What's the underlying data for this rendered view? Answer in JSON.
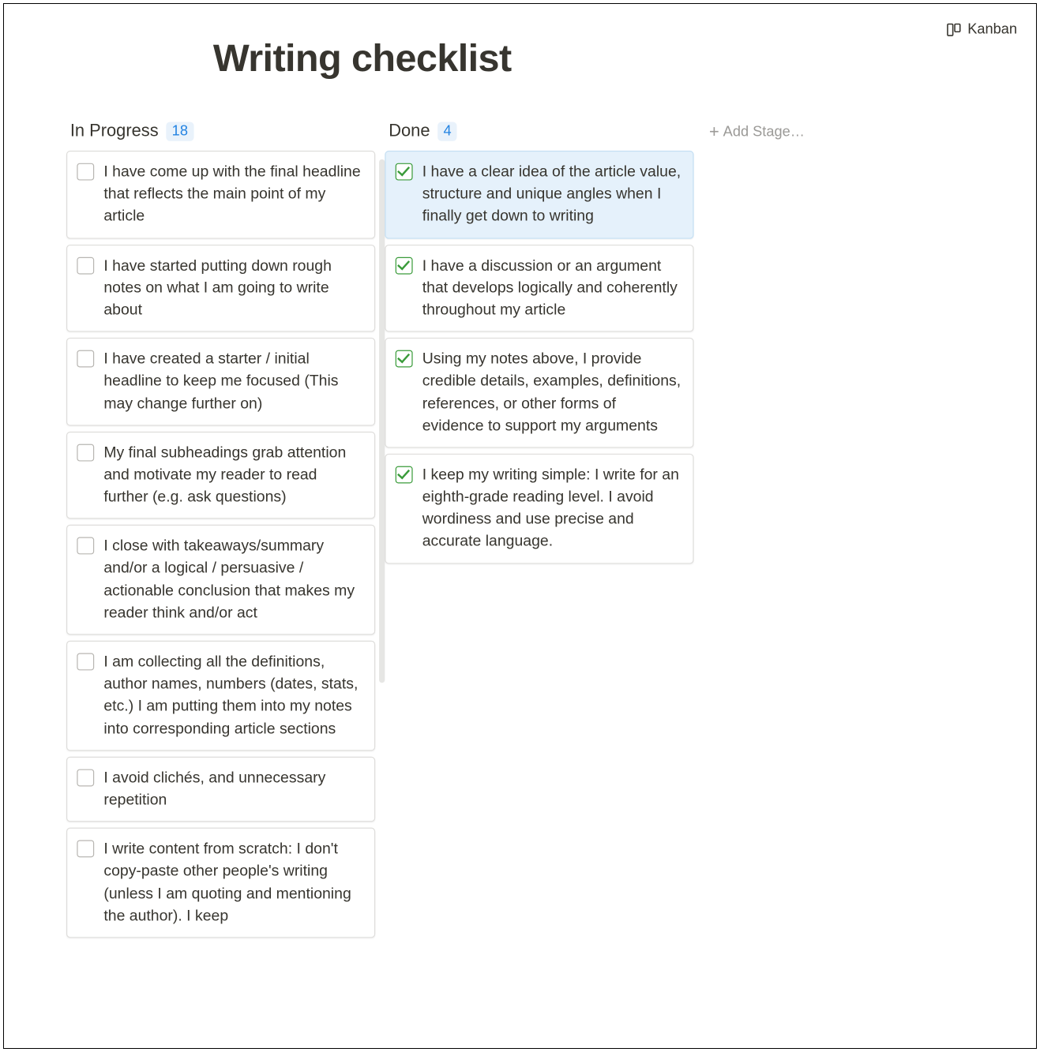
{
  "view_switch": {
    "label": "Kanban"
  },
  "title": "Writing checklist",
  "add_stage_label": "Add Stage…",
  "columns": [
    {
      "title": "In Progress",
      "count": "18",
      "cards": [
        {
          "text": "I have come up with the final headline that reflects the main point of my article",
          "checked": false,
          "selected": false
        },
        {
          "text": "I have started putting down rough notes on what I am going to write about",
          "checked": false,
          "selected": false
        },
        {
          "text": "I have created a starter / initial headline to keep me focused (This may change further on)",
          "checked": false,
          "selected": false
        },
        {
          "text": "My final subheadings grab attention and motivate my reader to read further (e.g. ask questions)",
          "checked": false,
          "selected": false
        },
        {
          "text": "I close with takeaways/summary and/or a logical / persuasive / actionable conclusion that makes my reader think and/or act",
          "checked": false,
          "selected": false
        },
        {
          "text": "I am collecting all the definitions, author names, numbers (dates, stats, etc.) I am putting them into my notes into corresponding article sections",
          "checked": false,
          "selected": false
        },
        {
          "text": "I avoid clichés, and unnecessary repetition",
          "checked": false,
          "selected": false
        },
        {
          "text": "I write content from scratch: I don't copy-paste other people's writing (unless I am quoting and mentioning the author). I keep",
          "checked": false,
          "selected": false
        }
      ]
    },
    {
      "title": "Done",
      "count": "4",
      "cards": [
        {
          "text": "I have a clear idea of the article value, structure and unique angles when I finally get down to writing",
          "checked": true,
          "selected": true
        },
        {
          "text": "I have a discussion or an argument that develops logically and coherently throughout my article",
          "checked": true,
          "selected": false
        },
        {
          "text": "Using my notes above, I provide credible details, examples, definitions, references, or other forms of evidence to support my arguments",
          "checked": true,
          "selected": false
        },
        {
          "text": "I keep my writing simple: I write for an eighth-grade reading level. I avoid wordiness and use precise and accurate language.",
          "checked": true,
          "selected": false
        }
      ]
    }
  ]
}
